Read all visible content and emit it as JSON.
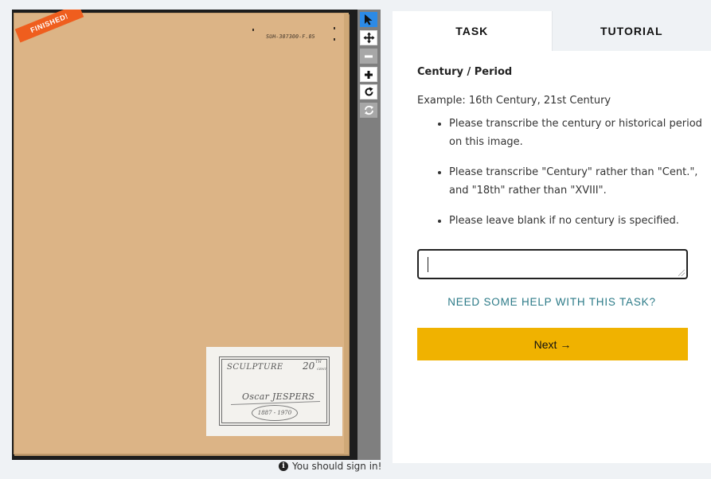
{
  "subject": {
    "status_ribbon": "FINISHED!",
    "barcode": "SUH-307300-F.05",
    "label": {
      "subject": "SCULPTURE",
      "century": "20",
      "century_sup": "TH",
      "century_sub": "CENT",
      "artist": "Oscar JESPERS",
      "dates": "1887 - 1970"
    }
  },
  "toolbar": {
    "tools": [
      {
        "name": "select",
        "icon": "cursor-arrow-icon"
      },
      {
        "name": "move",
        "icon": "move-arrows-icon"
      },
      {
        "name": "zoom-out",
        "icon": "minus-icon"
      },
      {
        "name": "zoom-in",
        "icon": "plus-icon"
      },
      {
        "name": "rotate",
        "icon": "rotate-icon"
      },
      {
        "name": "reset",
        "icon": "reset-icon"
      }
    ]
  },
  "signin": {
    "text": "You should sign in!",
    "icon": "info-icon"
  },
  "tabs": [
    {
      "label": "TASK",
      "active": true
    },
    {
      "label": "TUTORIAL",
      "active": false
    }
  ],
  "task": {
    "question": "Century / Period",
    "example": "Example: 16th Century, 21st Century",
    "instructions": [
      "Please transcribe the century or historical period on this image.",
      "Please transcribe \"Century\" rather than \"Cent.\", and \"18th\" rather than \"XVIII\".",
      "Please leave blank if no century is specified."
    ],
    "input_value": "",
    "help_link": "NEED SOME HELP WITH THIS TASK?",
    "next_label": "Next →"
  },
  "colors": {
    "accent_next": "#f0b200",
    "help_link": "#2b7a87",
    "active_tool": "#2c8ae6",
    "ribbon": "#ef5e1e",
    "folder": "#dcb486"
  }
}
